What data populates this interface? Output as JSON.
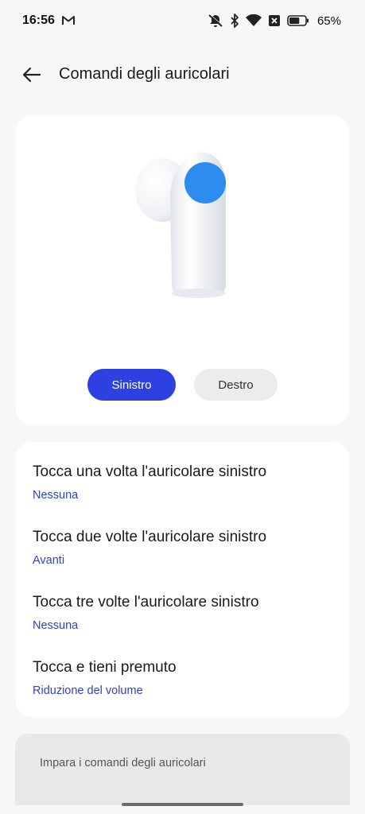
{
  "status_bar": {
    "time": "16:56",
    "battery_percent": "65%",
    "battery_level": 0.65,
    "icons": [
      "gmail-icon",
      "mute-vibrate-icon",
      "bluetooth-icon",
      "wifi-icon",
      "sim-off-icon",
      "battery-icon"
    ]
  },
  "header": {
    "title": "Comandi degli auricolari",
    "back_icon": "back-arrow-icon"
  },
  "earbud_card": {
    "image": "earbud-illustration",
    "highlight_color": "#2d8cf0",
    "tabs": [
      {
        "label": "Sinistro",
        "selected": true
      },
      {
        "label": "Destro",
        "selected": false
      }
    ]
  },
  "controls": [
    {
      "title": "Tocca una volta l'auricolare sinistro",
      "value": "Nessuna"
    },
    {
      "title": "Tocca due volte l'auricolare sinistro",
      "value": "Avanti"
    },
    {
      "title": "Tocca tre volte l'auricolare sinistro",
      "value": "Nessuna"
    },
    {
      "title": "Tocca e tieni premuto",
      "value": "Riduzione del volume"
    }
  ],
  "learn": {
    "label": "Impara i comandi degli auricolari"
  },
  "colors": {
    "accent": "#2d41e3",
    "link": "#2d41c8",
    "background": "#f7f7f7"
  }
}
